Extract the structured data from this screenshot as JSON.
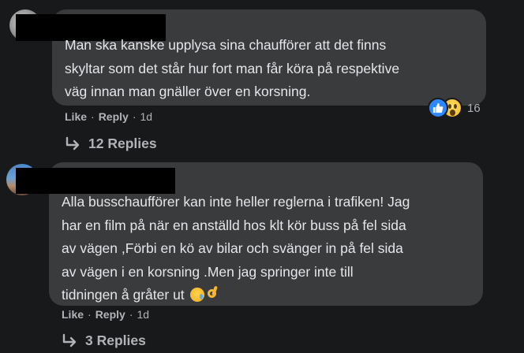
{
  "comments": [
    {
      "text_lines": [
        "Man ska kanske upplysa sina chaufförer att det finns",
        "skyltar som det står hur fort man får köra på respektive",
        "väg innan man gnäller över en korsning."
      ],
      "reaction_icons": [
        "like-icon",
        "wow-icon"
      ],
      "reaction_count": "16",
      "like_label": "Like",
      "reply_label": "Reply",
      "time": "1d",
      "replies_label": "12 Replies"
    },
    {
      "text_lines": [
        "Alla busschaufförer kan inte heller reglerna i trafiken! Jag",
        "har en film på när en anställd hos klt kör buss på fel sida",
        "av vägen ,Förbi en kö av bilar och svänger in på fel sida",
        "av vägen i en korsning .Men jag springer inte till",
        "tidningen å gråter ut"
      ],
      "emoji_icons": [
        "sad-tear-emoji-icon",
        "ok-hand-emoji-icon"
      ],
      "like_label": "Like",
      "reply_label": "Reply",
      "time": "1d",
      "replies_label": "3 Replies"
    }
  ],
  "colors": {
    "background": "#18191a",
    "bubble": "#3a3b3c",
    "text": "#e4e6eb",
    "secondary_text": "#b0b3b8",
    "like_blue": "#2d88ff"
  }
}
